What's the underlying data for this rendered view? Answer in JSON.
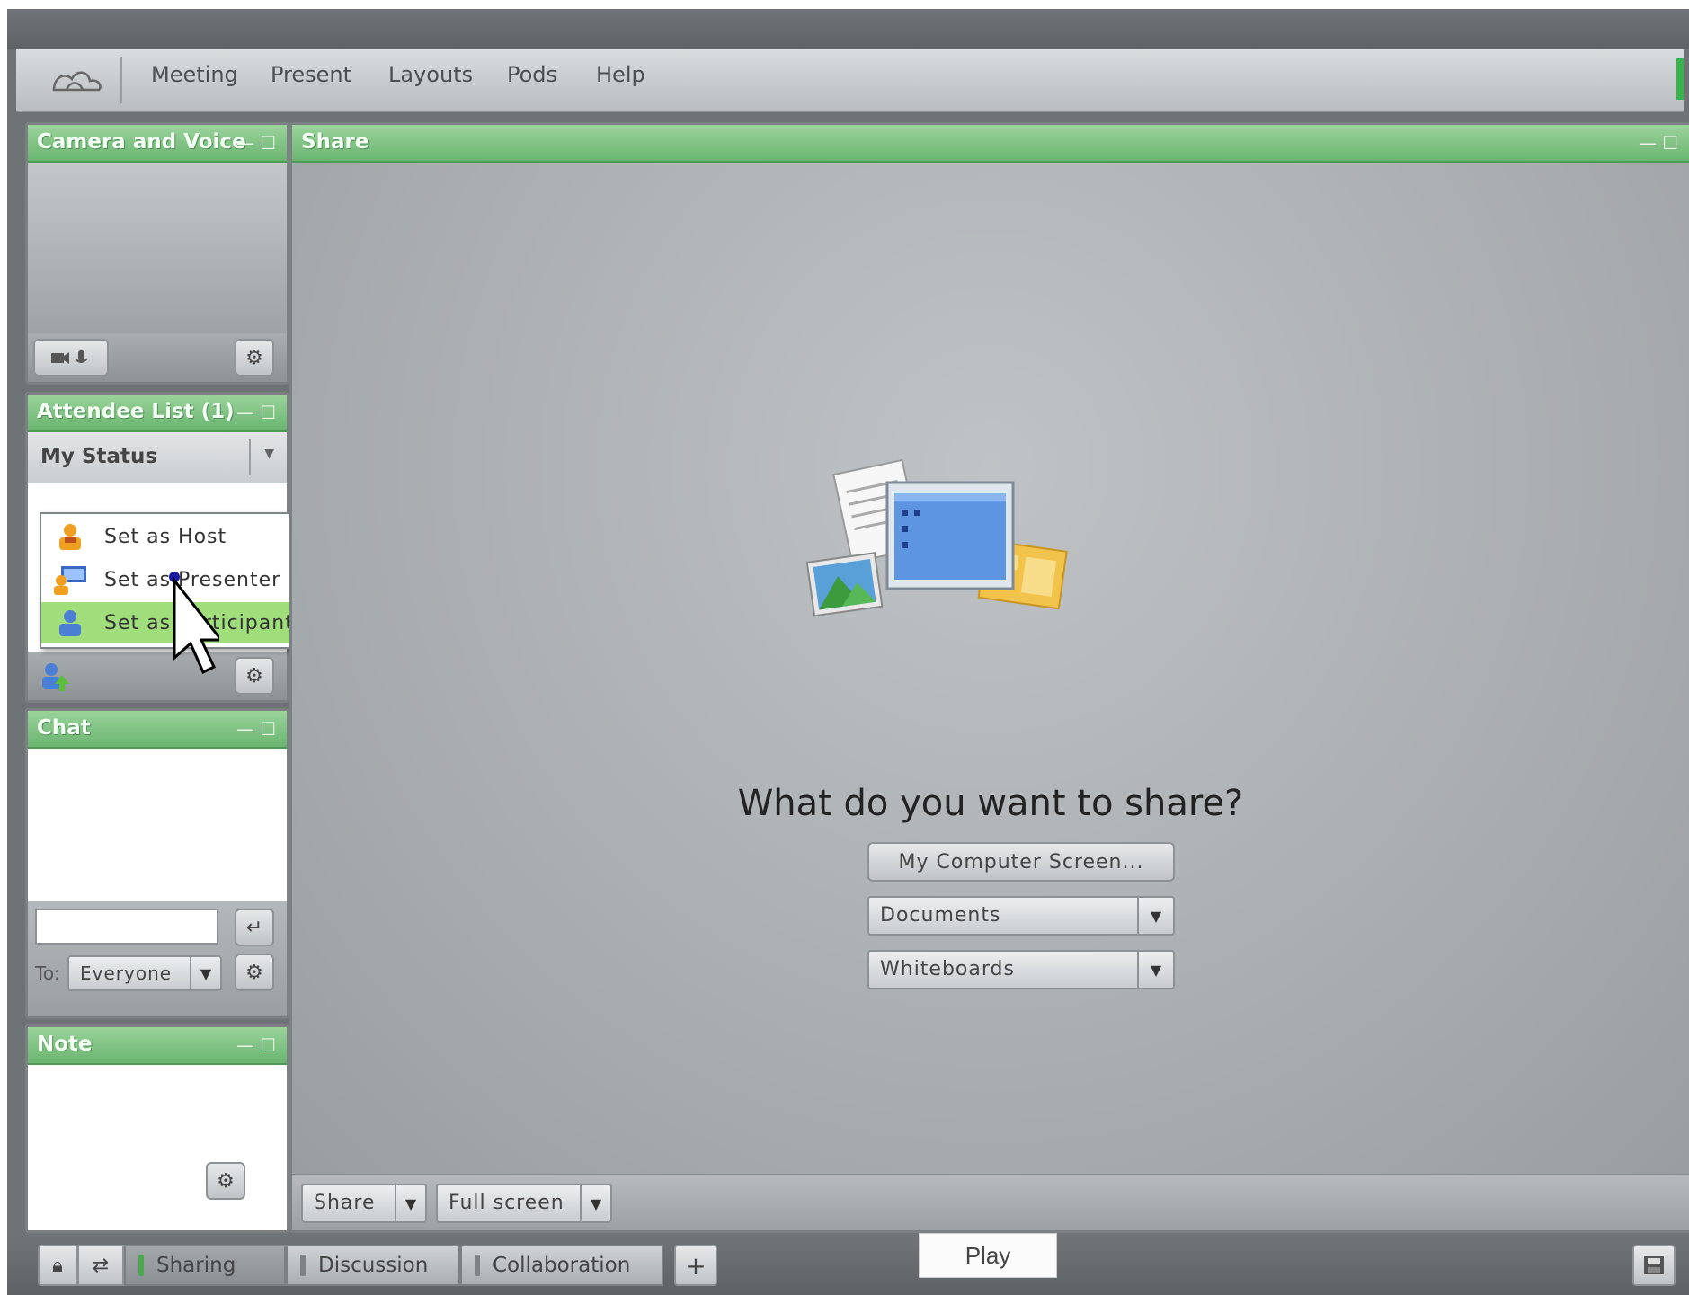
{
  "menu": {
    "items": [
      "Meeting",
      "Present",
      "Layouts",
      "Pods",
      "Help"
    ]
  },
  "pods": {
    "camera": {
      "title": "Camera and Voice"
    },
    "attendee": {
      "title": "Attendee List (1)",
      "my_status": "My Status",
      "role_menu": [
        "Set as Host",
        "Set as Presenter",
        "Set as Participant"
      ]
    },
    "chat": {
      "title": "Chat",
      "to_label": "To:",
      "recipient": "Everyone",
      "input_value": ""
    },
    "note": {
      "title": "Note"
    },
    "share": {
      "title": "Share",
      "question": "What do you want to share?",
      "screen_button": "My Computer Screen...",
      "documents": "Documents",
      "whiteboards": "Whiteboards",
      "share_menu": "Share",
      "fullscreen": "Full screen"
    }
  },
  "taskbar": {
    "tabs": [
      "Sharing",
      "Discussion",
      "Collaboration"
    ],
    "add": "+"
  },
  "overlay": {
    "play": "Play"
  },
  "colors": {
    "pod_header_green": "#7cc37f",
    "menu_highlight": "#9fde7a",
    "active_tab_marker": "#4aa84f"
  }
}
